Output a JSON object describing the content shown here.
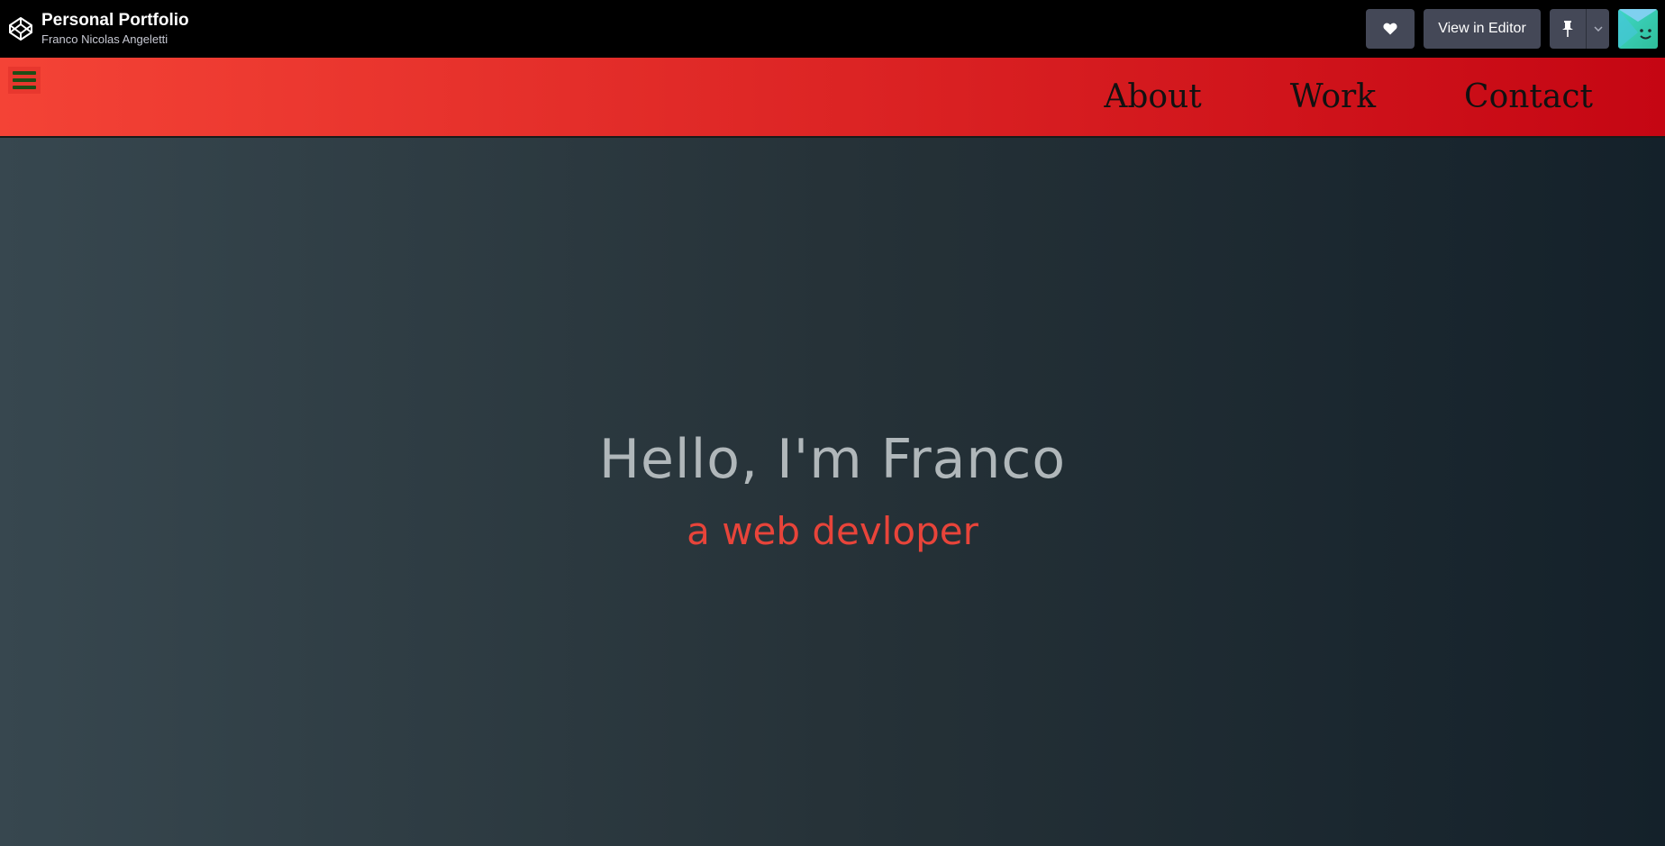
{
  "topbar": {
    "pen_title": "Personal Portfolio",
    "author": "Franco Nicolas Angeletti",
    "logo_icon": "codepen-logo-icon",
    "heart_icon": "heart-icon",
    "view_in_editor_label": "View in Editor",
    "pin_icon": "pin-icon",
    "caret_icon": "chevron-down-icon",
    "avatar_icon": "user-avatar"
  },
  "navbar": {
    "menu_icon": "hamburger-menu-icon",
    "links": [
      "About",
      "Work",
      "Contact"
    ]
  },
  "hero": {
    "title": "Hello, I'm Franco",
    "subtitle": "a web devloper"
  },
  "colors": {
    "topbar_bg": "#000000",
    "button_bg": "#444857",
    "navbar_gradient_start": "#f44336",
    "navbar_gradient_end": "#c50613",
    "hero_gradient_start": "#37474f",
    "hero_gradient_end": "#14212a",
    "hero_title": "#b0b7ba",
    "hero_subtitle": "#e8443a"
  }
}
